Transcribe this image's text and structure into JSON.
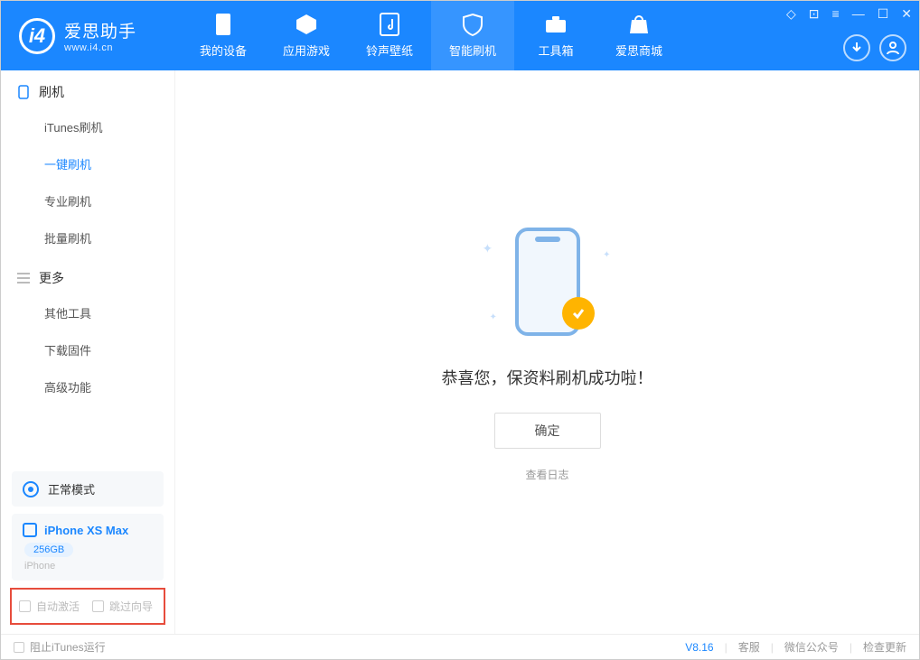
{
  "header": {
    "app_name": "爱思助手",
    "url": "www.i4.cn",
    "tabs": [
      {
        "label": "我的设备"
      },
      {
        "label": "应用游戏"
      },
      {
        "label": "铃声壁纸"
      },
      {
        "label": "智能刷机"
      },
      {
        "label": "工具箱"
      },
      {
        "label": "爱思商城"
      }
    ]
  },
  "sidebar": {
    "section1_title": "刷机",
    "section1_items": [
      {
        "label": "iTunes刷机"
      },
      {
        "label": "一键刷机"
      },
      {
        "label": "专业刷机"
      },
      {
        "label": "批量刷机"
      }
    ],
    "section2_title": "更多",
    "section2_items": [
      {
        "label": "其他工具"
      },
      {
        "label": "下载固件"
      },
      {
        "label": "高级功能"
      }
    ],
    "mode_label": "正常模式",
    "device_name": "iPhone XS Max",
    "device_storage": "256GB",
    "device_type": "iPhone",
    "checkbox1": "自动激活",
    "checkbox2": "跳过向导"
  },
  "main": {
    "success_text": "恭喜您，保资料刷机成功啦！",
    "ok_label": "确定",
    "view_log": "查看日志"
  },
  "footer": {
    "block_itunes": "阻止iTunes运行",
    "version": "V8.16",
    "link1": "客服",
    "link2": "微信公众号",
    "link3": "检查更新"
  }
}
